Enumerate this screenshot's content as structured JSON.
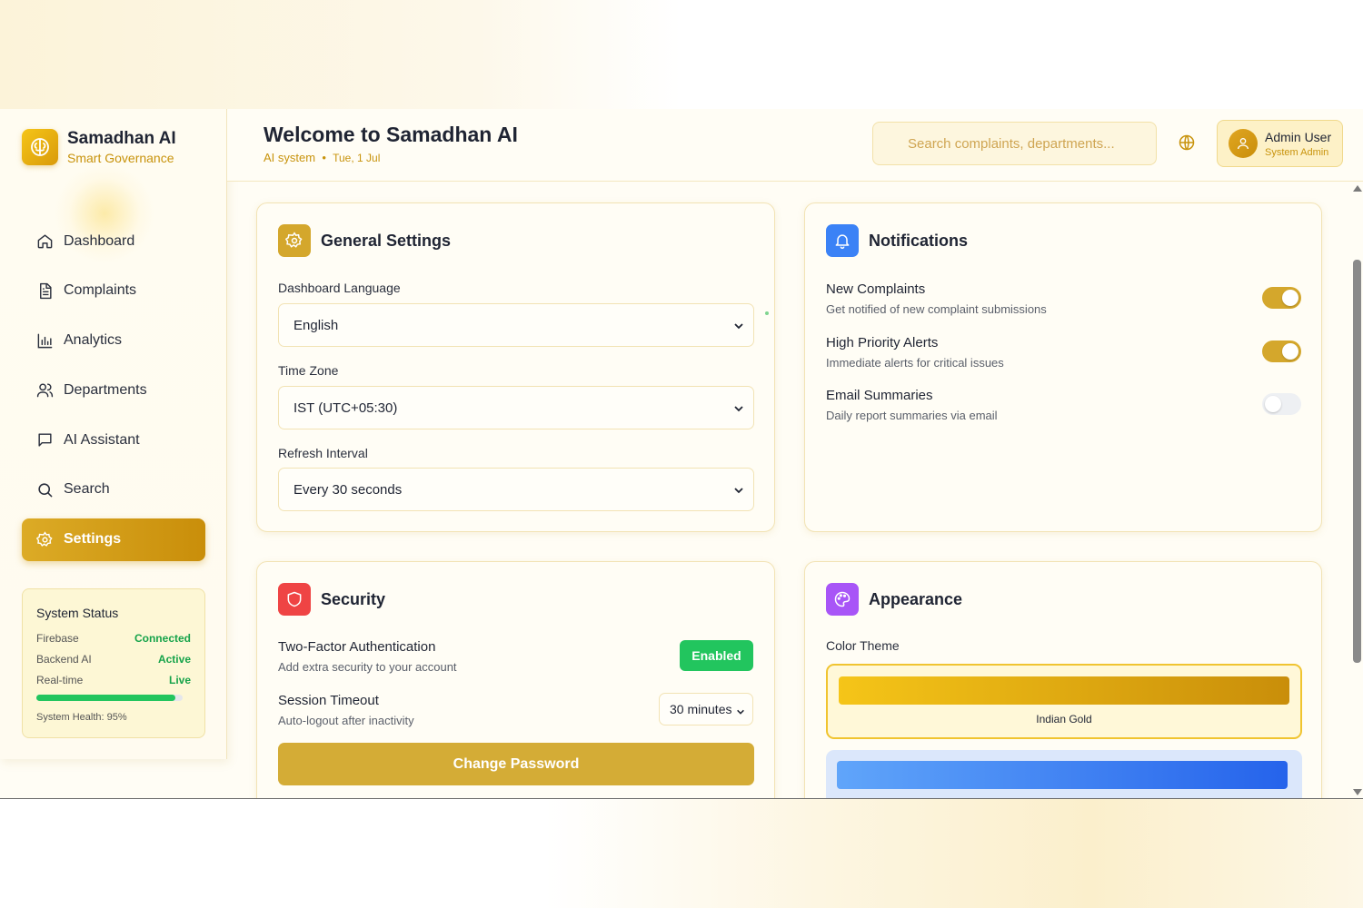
{
  "brand": {
    "title": "Samadhan AI",
    "subtitle": "Smart Governance"
  },
  "nav": [
    {
      "label": "Dashboard",
      "icon": "home-icon"
    },
    {
      "label": "Complaints",
      "icon": "document-icon"
    },
    {
      "label": "Analytics",
      "icon": "bar-chart-icon"
    },
    {
      "label": "Departments",
      "icon": "users-icon"
    },
    {
      "label": "AI Assistant",
      "icon": "message-icon"
    },
    {
      "label": "Search",
      "icon": "search-icon"
    },
    {
      "label": "Settings",
      "icon": "gear-icon",
      "active": true
    }
  ],
  "system_status": {
    "title": "System Status",
    "rows": [
      {
        "label": "Firebase",
        "value": "Connected"
      },
      {
        "label": "Backend AI",
        "value": "Active"
      },
      {
        "label": "Real-time",
        "value": "Live"
      }
    ],
    "health_fraction": 0.95,
    "health_text": "System Health: 95%"
  },
  "header": {
    "title": "Welcome to Samadhan AI",
    "subtitle": "AI system",
    "separator": "•",
    "date": "Tue, 1 Jul",
    "search_placeholder": "Search complaints, departments...",
    "user_name": "Admin User",
    "user_role": "System Admin"
  },
  "general": {
    "title": "General Settings",
    "language_label": "Dashboard Language",
    "language_value": "English",
    "timezone_label": "Time Zone",
    "timezone_value": "IST (UTC+05:30)",
    "refresh_label": "Refresh Interval",
    "refresh_value": "Every 30 seconds"
  },
  "notifications": {
    "title": "Notifications",
    "items": [
      {
        "title": "New Complaints",
        "desc": "Get notified of new complaint submissions",
        "on": true
      },
      {
        "title": "High Priority Alerts",
        "desc": "Immediate alerts for critical issues",
        "on": true
      },
      {
        "title": "Email Summaries",
        "desc": "Daily report summaries via email",
        "on": false
      }
    ]
  },
  "security": {
    "title": "Security",
    "twofa_title": "Two-Factor Authentication",
    "twofa_desc": "Add extra security to your account",
    "twofa_status": "Enabled",
    "session_title": "Session Timeout",
    "session_desc": "Auto-logout after inactivity",
    "session_value": "30 minutes",
    "change_password": "Change Password"
  },
  "appearance": {
    "title": "Appearance",
    "theme_label": "Color Theme",
    "themes": [
      {
        "name": "Indian Gold",
        "selected": true
      }
    ]
  },
  "colors": {
    "accent_gold": "#d4a72c",
    "blue": "#3b82f6",
    "red": "#ef4444",
    "purple": "#a855f7",
    "green": "#22c55e"
  }
}
